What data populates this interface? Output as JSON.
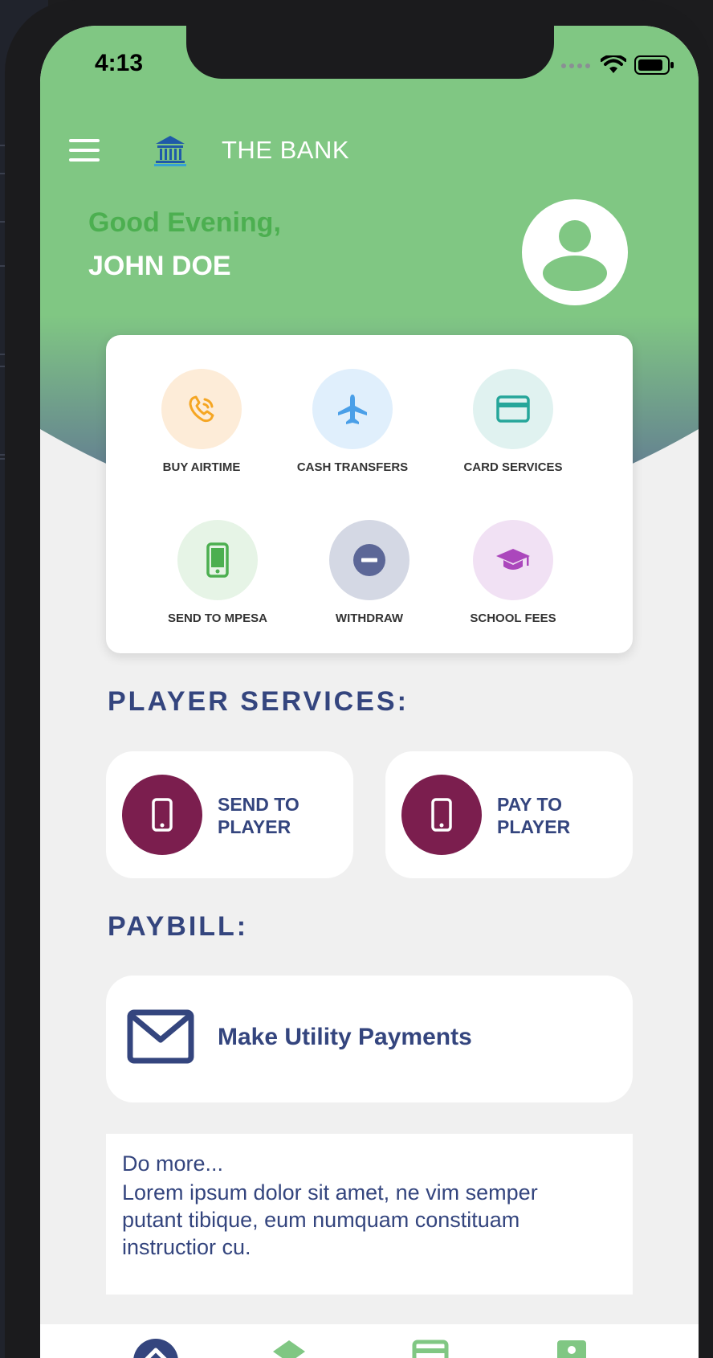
{
  "status_bar": {
    "time": "4:13"
  },
  "header": {
    "app_title": "THE BANK"
  },
  "greeting": {
    "salutation": "Good Evening,",
    "name": "JOHN DOE"
  },
  "quick_services": [
    {
      "label": "BUY AIRTIME",
      "icon": "phone-call-icon",
      "color": "#f5a623"
    },
    {
      "label": "CASH TRANSFERS",
      "icon": "airplane-icon",
      "color": "#4a9fe8"
    },
    {
      "label": "CARD SERVICES",
      "icon": "credit-card-icon",
      "color": "#26a69a"
    },
    {
      "label": "SEND TO MPESA",
      "icon": "mobile-phone-icon",
      "color": "#4caf50"
    },
    {
      "label": "WITHDRAW",
      "icon": "minus-circle-icon",
      "color": "#5c6797"
    },
    {
      "label": "SCHOOL FEES",
      "icon": "graduation-cap-icon",
      "color": "#ab47bc"
    }
  ],
  "player_services": {
    "title": "PLAYER SERVICES:",
    "items": [
      {
        "label": "SEND TO PLAYER",
        "icon": "mobile-phone-icon"
      },
      {
        "label": "PAY TO PLAYER",
        "icon": "mobile-phone-icon"
      }
    ]
  },
  "paybill": {
    "title": "PAYBILL:",
    "utility_label": "Make Utility Payments",
    "icon": "envelope-icon"
  },
  "do_more": {
    "title": "Do more...",
    "body": "Lorem ipsum dolor sit amet, ne vim semper putant tibique, eum numquam constituam instructior cu."
  },
  "bottom_nav": [
    {
      "icon": "home-icon",
      "active": true
    },
    {
      "icon": "bank-icon",
      "active": false
    },
    {
      "icon": "card-icon",
      "active": false
    },
    {
      "icon": "profile-icon",
      "active": false
    }
  ],
  "colors": {
    "header_green": "#80c783",
    "accent_blue": "#34457e",
    "player_maroon": "#7b1e4e",
    "greeting_green": "#4caf50"
  }
}
